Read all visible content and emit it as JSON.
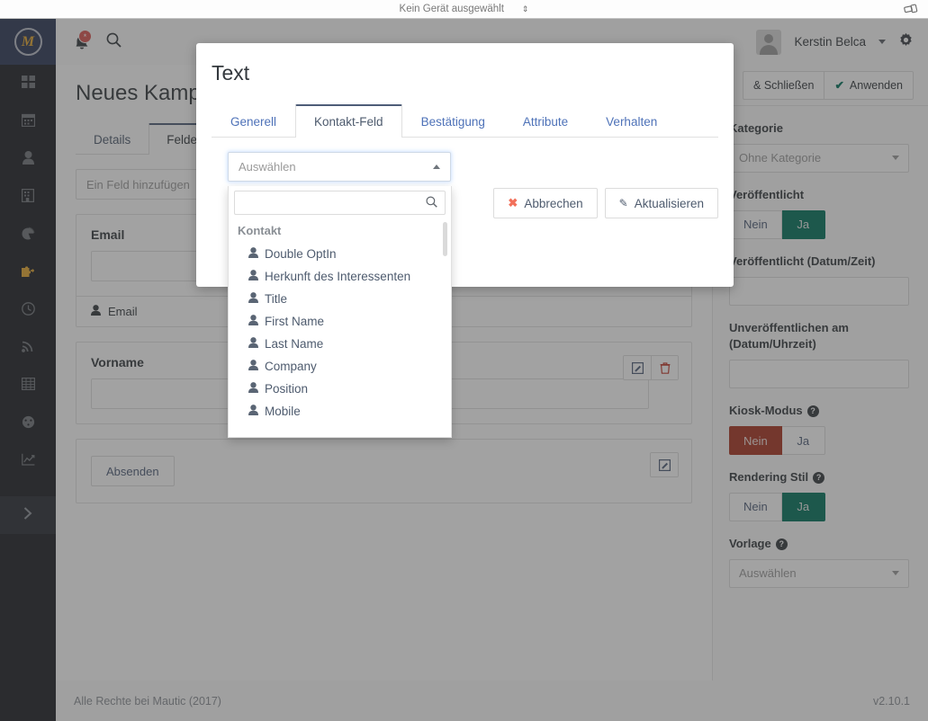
{
  "device_bar": {
    "label": "Kein Gerät ausgewählt",
    "spinner": "⇕",
    "rotate_icon": "rotate-device-icon"
  },
  "topbar": {
    "notification_count": "",
    "username": "Kerstin Belca",
    "search_icon": "search-icon",
    "bell_icon": "bell-icon",
    "gear_icon": "gear-icon"
  },
  "sidebar": {
    "logo": "M",
    "items": [
      {
        "name": "dashboard",
        "icon": "grid-icon",
        "active": false
      },
      {
        "name": "calendar",
        "icon": "calendar-icon",
        "active": false
      },
      {
        "name": "contacts",
        "icon": "person-icon",
        "active": false
      },
      {
        "name": "companies",
        "icon": "building-icon",
        "active": false
      },
      {
        "name": "segments",
        "icon": "pie-chart-icon",
        "active": false
      },
      {
        "name": "components",
        "icon": "puzzle-icon",
        "active": true
      },
      {
        "name": "points",
        "icon": "clock-icon",
        "active": false
      },
      {
        "name": "channels",
        "icon": "rss-icon",
        "active": false
      },
      {
        "name": "reports",
        "icon": "table-icon",
        "active": false
      },
      {
        "name": "stages",
        "icon": "gauge-icon",
        "active": false
      },
      {
        "name": "analytics",
        "icon": "line-chart-icon",
        "active": false
      }
    ],
    "expander_icon": "chevron-right-icon"
  },
  "main": {
    "page_title": "Neues Kampagnenformular",
    "tabs": [
      {
        "label": "Details",
        "active": false
      },
      {
        "label": "Felder",
        "active": true
      }
    ],
    "add_field_placeholder": "Ein Feld hinzufügen",
    "fields": [
      {
        "label": "Email",
        "tag": "Email",
        "value": "",
        "has_tag": true,
        "has_delete": false
      },
      {
        "label": "Vorname",
        "tag": "",
        "value": "",
        "has_tag": false,
        "has_delete": true
      }
    ],
    "submit_label": "Absenden",
    "edit_icon": "edit-icon",
    "delete_icon": "trash-icon"
  },
  "right_panel": {
    "actions": [
      {
        "label": "& Schließen",
        "icon": ""
      },
      {
        "label": "Anwenden",
        "icon": "check-icon"
      }
    ],
    "category_label": "Kategorie",
    "category_value": "Ohne Kategorie",
    "published_label": "Veröffentlicht",
    "published_no": "Nein",
    "published_yes": "Ja",
    "published_state": "yes",
    "publish_date_label": "Veröffentlicht (Datum/Zeit)",
    "publish_date_value": "",
    "unpublish_date_label": "Unveröffentlichen am (Datum/Uhrzeit)",
    "unpublish_date_value": "",
    "kiosk_label": "Kiosk-Modus",
    "kiosk_no": "Nein",
    "kiosk_yes": "Ja",
    "kiosk_state": "no",
    "rendering_label": "Rendering Stil",
    "rendering_no": "Nein",
    "rendering_yes": "Ja",
    "rendering_state": "yes",
    "template_label": "Vorlage",
    "template_value": "Auswählen",
    "help_icon": "question-mark-icon"
  },
  "footer": {
    "copyright": "Alle Rechte bei Mautic (2017)",
    "version": "v2.10.1"
  },
  "modal": {
    "title": "Text",
    "tabs": [
      {
        "label": "Generell",
        "active": false
      },
      {
        "label": "Kontakt-Feld",
        "active": true
      },
      {
        "label": "Bestätigung",
        "active": false
      },
      {
        "label": "Attribute",
        "active": false
      },
      {
        "label": "Verhalten",
        "active": false
      }
    ],
    "select_placeholder": "Auswählen",
    "cancel_label": "Abbrechen",
    "update_label": "Aktualisieren",
    "cancel_icon": "x-icon",
    "update_icon": "pencil-icon",
    "caret_icon": "caret-up-icon"
  },
  "dropdown": {
    "search_value": "",
    "search_icon": "search-icon",
    "group_label": "Kontakt",
    "items": [
      "Double OptIn",
      "Herkunft des Interessenten",
      "Title",
      "First Name",
      "Last Name",
      "Company",
      "Position",
      "Mobile"
    ],
    "item_icon": "person-icon"
  },
  "colors": {
    "accent_navy": "#2b3655",
    "accent_gold": "#e5a82e",
    "green": "#00725a",
    "red": "#a8331f",
    "link_blue": "#4e72b8"
  }
}
